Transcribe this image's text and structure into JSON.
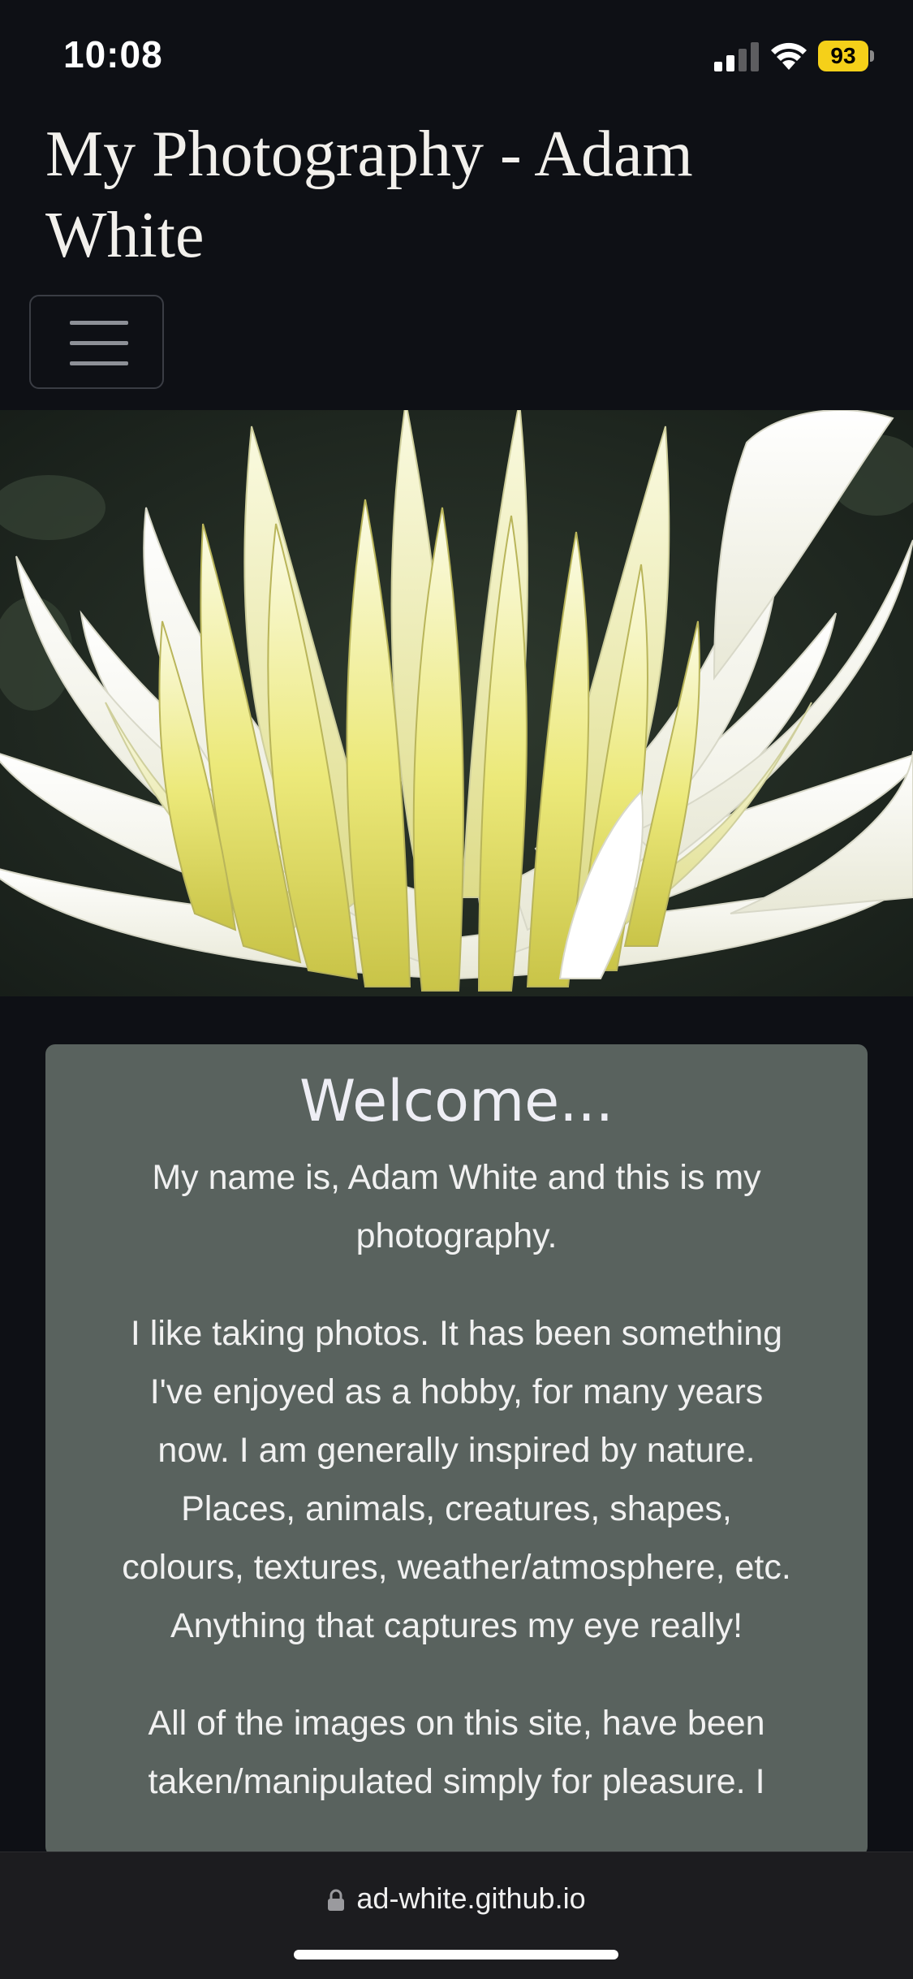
{
  "status_bar": {
    "time": "10:08",
    "battery_level": "93"
  },
  "header": {
    "site_title": "My Photography - Adam White"
  },
  "hero": {
    "subject": "white-yellow dahlia flower photo"
  },
  "welcome": {
    "heading": "Welcome...",
    "paragraphs": [
      "My name is, Adam White and this is my photography.",
      "I like taking photos. It has been something I've enjoyed as a hobby, for many years now. I am generally inspired by nature. Places, animals, creatures, shapes, colours, textures, weather/atmosphere, etc. Anything that captures my eye really!",
      "All of the images on this site, have been taken/manipulated simply for pleasure. I"
    ]
  },
  "browser": {
    "url": "ad-white.github.io"
  },
  "colors": {
    "background": "#0e1015",
    "card": "#59625e",
    "battery": "#f5d019"
  }
}
